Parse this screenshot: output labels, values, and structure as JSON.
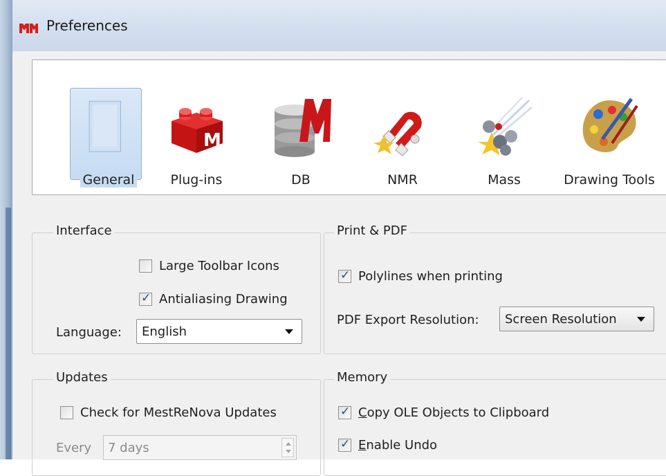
{
  "window": {
    "title": "Preferences"
  },
  "toolbar": {
    "items": [
      {
        "label": "General",
        "icon": "general-page-icon",
        "selected": true
      },
      {
        "label": "Plug-ins",
        "icon": "plugin-brick-icon"
      },
      {
        "label": "DB",
        "icon": "database-icon"
      },
      {
        "label": "NMR",
        "icon": "magnet-icon"
      },
      {
        "label": "Mass",
        "icon": "mass-spec-icon"
      },
      {
        "label": "Drawing Tools",
        "icon": "palette-icon"
      }
    ]
  },
  "interface": {
    "title": "Interface",
    "large_toolbar_icons": {
      "label": "Large Toolbar Icons",
      "checked": false
    },
    "antialiasing": {
      "label": "Antialiasing Drawing",
      "checked": true
    },
    "language_label": "Language:",
    "language_value": "English"
  },
  "print": {
    "title": "Print & PDF",
    "polylines": {
      "label": "Polylines when printing",
      "checked": true
    },
    "pdf_res_label": "PDF Export Resolution:",
    "pdf_res_value": "Screen Resolution"
  },
  "updates": {
    "title": "Updates",
    "check": {
      "label": "Check for MestReNova Updates",
      "checked": false
    },
    "every_label": "Every",
    "every_value": "7 days"
  },
  "memory": {
    "title": "Memory",
    "copy_ole": {
      "label_first": "C",
      "label_rest": "opy OLE Objects to Clipboard",
      "checked": true
    },
    "undo": {
      "label_first": "E",
      "label_rest": "nable Undo",
      "checked": true
    }
  },
  "colors": {
    "accent": "#c6dcf3",
    "title_bar": "#d2deee"
  }
}
